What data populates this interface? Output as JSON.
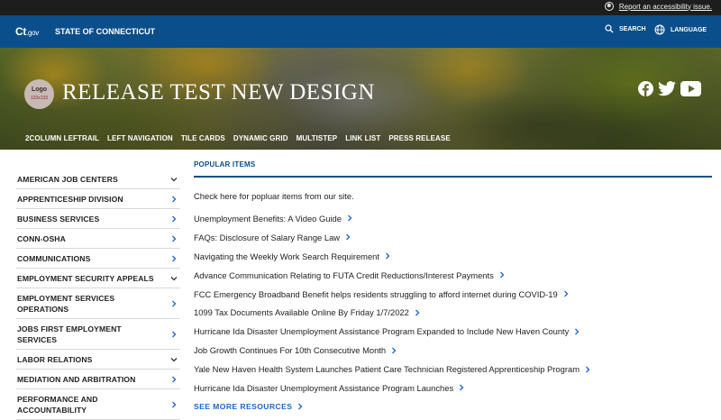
{
  "utility": {
    "accessibility_icon": "accessibility-icon",
    "accessibility_text": "Report an accessibility issue."
  },
  "topbar": {
    "logo_ct": "Ct",
    "logo_gov": ".gov",
    "state_name": "STATE OF CONNECTICUT",
    "search_label": "SEARCH",
    "language_label": "LANGUAGE"
  },
  "hero": {
    "logo_text": "Logo",
    "logo_size": "133x133",
    "title": "RELEASE TEST NEW DESIGN",
    "social_icons": [
      "facebook-icon",
      "twitter-icon",
      "youtube-icon"
    ],
    "subnav": [
      "2COLUMN LEFTRAIL",
      "LEFT NAVIGATION",
      "TILE CARDS",
      "DYNAMIC GRID",
      "MULTISTEP",
      "LINK LIST",
      "PRESS RELEASE"
    ]
  },
  "sidebar": {
    "items": [
      {
        "label": "AMERICAN JOB CENTERS",
        "icon": "chevron-down-icon"
      },
      {
        "label": "APPRENTICESHIP DIVISION",
        "icon": "chevron-right-icon"
      },
      {
        "label": "BUSINESS SERVICES",
        "icon": "chevron-right-icon"
      },
      {
        "label": "CONN-OSHA",
        "icon": "chevron-right-icon"
      },
      {
        "label": "COMMUNICATIONS",
        "icon": "chevron-right-icon"
      },
      {
        "label": "EMPLOYMENT SECURITY APPEALS",
        "icon": "chevron-down-icon"
      },
      {
        "label": "EMPLOYMENT SERVICES OPERATIONS",
        "icon": "chevron-right-icon"
      },
      {
        "label": "JOBS FIRST EMPLOYMENT SERVICES",
        "icon": "chevron-right-icon"
      },
      {
        "label": "LABOR RELATIONS",
        "icon": "chevron-down-icon"
      },
      {
        "label": "MEDIATION AND ARBITRATION",
        "icon": "chevron-right-icon"
      },
      {
        "label": "PERFORMANCE AND ACCOUNTABILITY",
        "icon": "chevron-right-icon"
      }
    ]
  },
  "main": {
    "section_title": "POPULAR ITEMS",
    "intro": "Check here for popluar items from our site.",
    "links": [
      "Unemployment Benefits: A Video Guide",
      "FAQs: Disclosure of Salary Range Law",
      "Navigating the Weekly Work Search Requirement",
      "Advance Communication Relating to FUTA Credit Reductions/Interest Payments",
      "FCC Emergency Broadband Benefit helps residents struggling to afford internet during COVID-19",
      "1099 Tax Documents Available Online By Friday 1/7/2022",
      "Hurricane Ida Disaster Unemployment Assistance Program Expanded to Include New Haven County",
      "Job Growth Continues For 10th Consecutive Month",
      "Yale New Haven Health System Launches Patient Care Technician Registered Apprenticeship Program",
      "Hurricane Ida Disaster Unemployment Assistance Program Launches"
    ],
    "more_label": "SEE MORE RESOURCES"
  },
  "colors": {
    "brand_blue": "#0b4e8c",
    "link_blue": "#1a66c9",
    "utility_bg": "#1d1d1d"
  }
}
